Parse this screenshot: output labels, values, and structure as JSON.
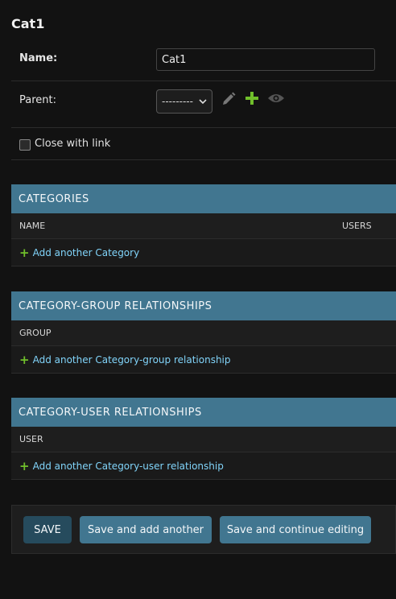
{
  "page": {
    "title": "Cat1"
  },
  "form": {
    "name_label": "Name:",
    "name_value": "Cat1",
    "parent_label": "Parent:",
    "parent_selected": "---------",
    "close_with_link_label": "Close with link"
  },
  "inlines": [
    {
      "heading": "CATEGORIES",
      "columns": [
        "NAME",
        "USERS"
      ],
      "add_label": "Add another Category"
    },
    {
      "heading": "CATEGORY-GROUP RELATIONSHIPS",
      "columns": [
        "GROUP"
      ],
      "add_label": "Add another Category-group relationship"
    },
    {
      "heading": "CATEGORY-USER RELATIONSHIPS",
      "columns": [
        "USER"
      ],
      "add_label": "Add another Category-user relationship"
    }
  ],
  "actions": {
    "save": "SAVE",
    "save_add_another": "Save and add another",
    "save_continue": "Save and continue editing"
  },
  "icons": {
    "edit": "pencil-icon",
    "add": "plus-icon",
    "view": "eye-icon"
  },
  "colors": {
    "header": "#417690",
    "link": "#81d4fa",
    "add_green": "#70bf2b",
    "background": "#121212"
  }
}
